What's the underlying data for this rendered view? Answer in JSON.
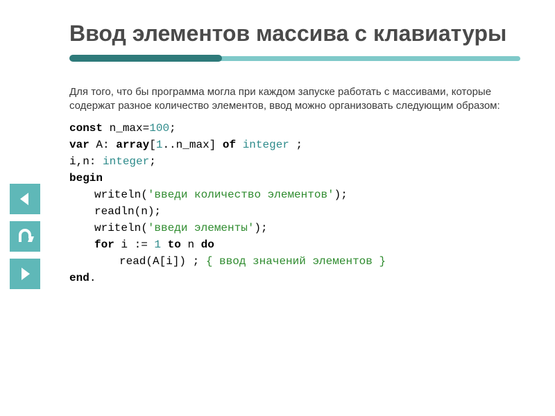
{
  "slide": {
    "title": "Ввод элементов массива с клавиатуры",
    "intro": "Для того, что бы программа могла при каждом запуске работать с массивами, которые содержат разное количество элементов, ввод можно организовать следующим образом:",
    "code": {
      "l1_const": "const",
      "l1_rest": " n_max=",
      "l1_num": "100",
      "l1_end": ";",
      "l2_var": "var",
      "l2_a": " A: ",
      "l2_array": "array",
      "l2_brk": "[",
      "l2_n1": "1",
      "l2_dots": "..n_max] ",
      "l2_of": "of",
      "l2_sp": " ",
      "l2_type": "integer",
      "l2_end": " ;",
      "l3_a": "i,n: ",
      "l3_type": "integer",
      "l3_end": ";",
      "l4": "begin",
      "l5_a": "writeln(",
      "l5_str": "'введи количество элементов'",
      "l5_end": ");",
      "l6": "readln(n);",
      "l7_a": "writeln(",
      "l7_str": "'введи элементы'",
      "l7_end": ");",
      "l8_for": "for",
      "l8_a": " i := ",
      "l8_n1": "1",
      "l8_to": " to",
      "l8_b": " n ",
      "l8_do": "do",
      "l9_a": "read(A[i]) ; ",
      "l9_cmt": "{ ввод значений элементов }",
      "l10": "end",
      "l10_dot": "."
    }
  },
  "nav": {
    "prev": "prev",
    "home": "home",
    "next": "next"
  }
}
